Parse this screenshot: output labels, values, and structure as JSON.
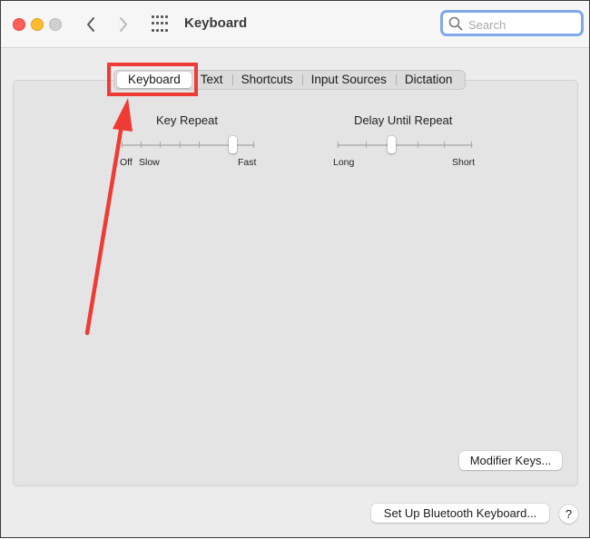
{
  "window": {
    "title": "Keyboard"
  },
  "toolbar": {
    "back_icon": "chevron-left-icon",
    "forward_icon": "chevron-right-icon",
    "grid_icon": "show-all-grid-icon",
    "search": {
      "placeholder": "Search",
      "value": ""
    }
  },
  "tabs": [
    {
      "label": "Keyboard",
      "selected": true
    },
    {
      "label": "Text",
      "selected": false
    },
    {
      "label": "Shortcuts",
      "selected": false
    },
    {
      "label": "Input Sources",
      "selected": false
    },
    {
      "label": "Dictation",
      "selected": false
    }
  ],
  "key_repeat": {
    "title": "Key Repeat",
    "labels": [
      "Off",
      "Slow",
      "Fast"
    ],
    "tick_count": 7,
    "value_step": 5
  },
  "delay_until_repeat": {
    "title": "Delay Until Repeat",
    "labels": [
      "Long",
      "Short"
    ],
    "tick_count": 6,
    "value_step": 2
  },
  "buttons": {
    "modifier_keys": "Modifier Keys...",
    "bluetooth": "Set Up Bluetooth Keyboard...",
    "help": "?"
  },
  "annotation": {
    "color": "#ef3b35",
    "target": "Keyboard tab"
  }
}
